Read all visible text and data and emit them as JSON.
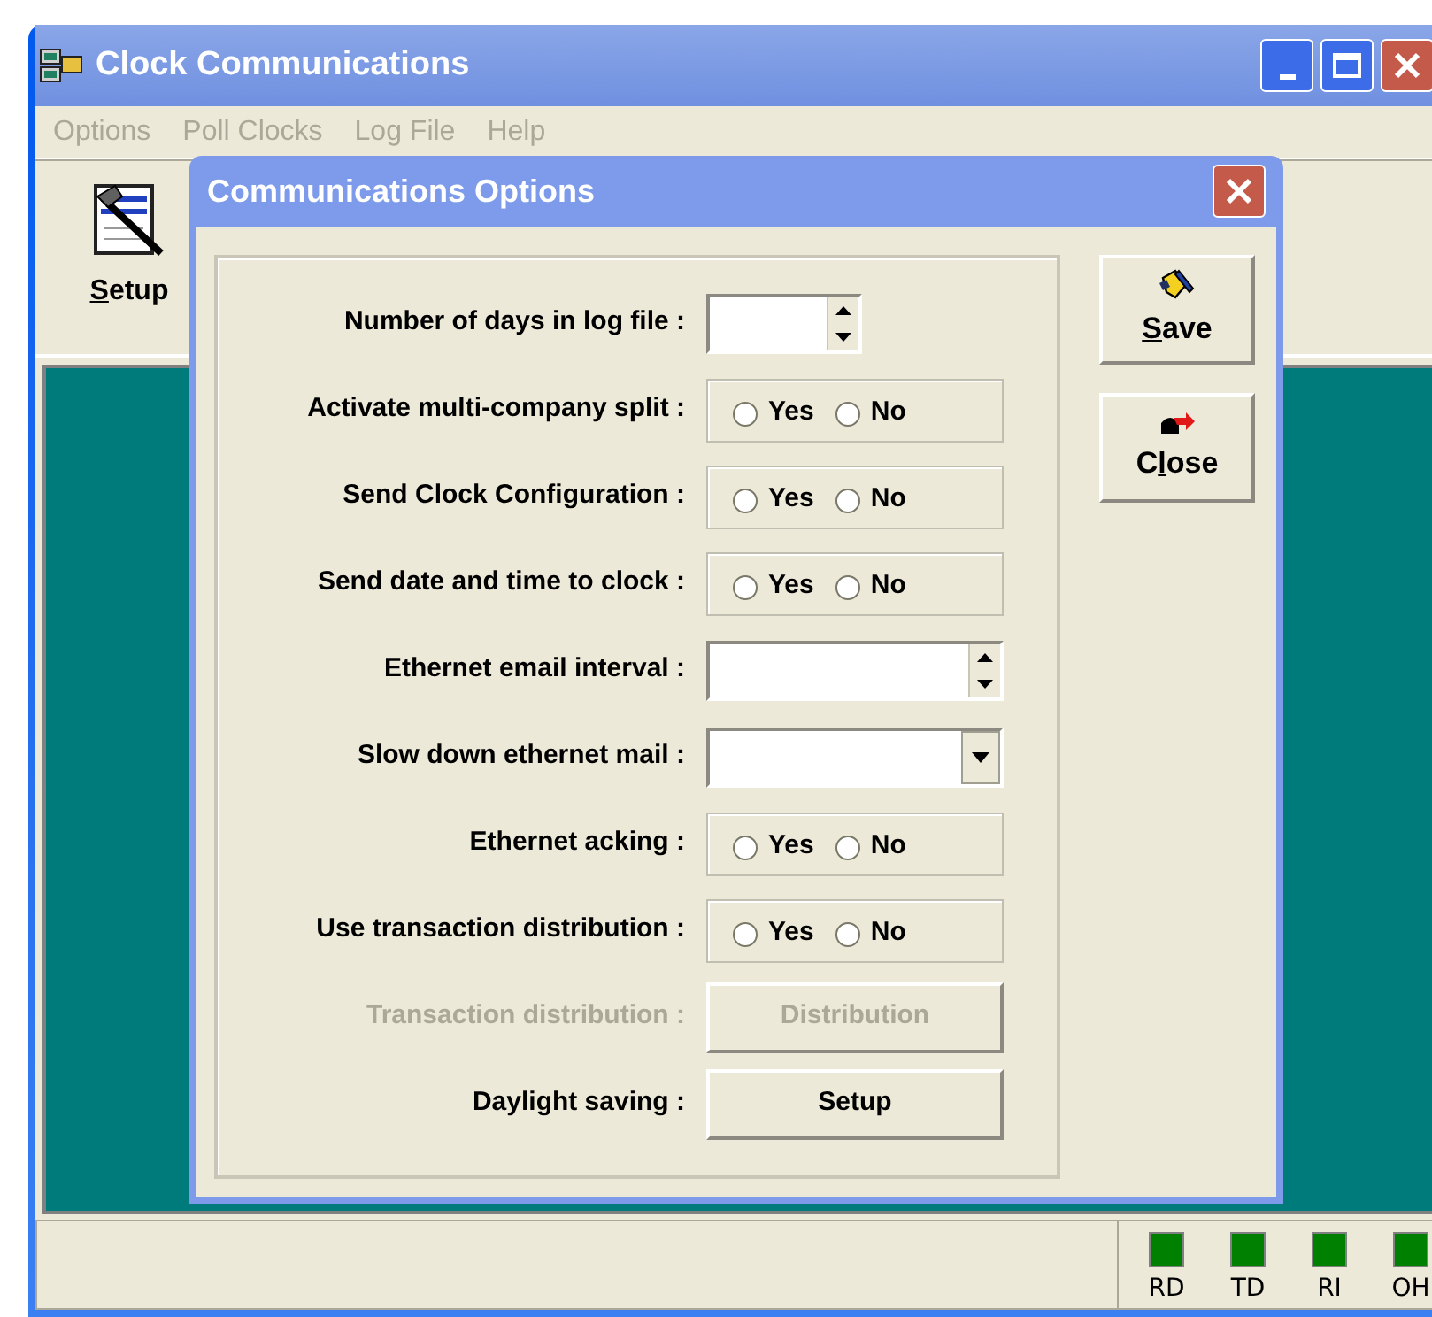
{
  "window": {
    "title": "Clock Communications"
  },
  "menu": [
    {
      "label": "Options",
      "disabled": true
    },
    {
      "label": "Poll Clocks",
      "disabled": true
    },
    {
      "label": "Log File",
      "disabled": true
    },
    {
      "label": "Help",
      "disabled": true
    }
  ],
  "toolbar": [
    {
      "label": "Setup"
    }
  ],
  "dialog": {
    "title": "Communications Options",
    "rows": [
      {
        "kind": "spin",
        "label": "Number of days in log file :",
        "compact": true,
        "disabled": false
      },
      {
        "kind": "radio",
        "label": "Activate multi-company split :",
        "disabled": false,
        "options": [
          {
            "label": "Yes",
            "selected": false
          },
          {
            "label": "No",
            "selected": false
          }
        ]
      },
      {
        "kind": "radio",
        "label": "Send Clock Configuration :",
        "disabled": false,
        "options": [
          {
            "label": "Yes",
            "selected": false
          },
          {
            "label": "No",
            "selected": false
          }
        ]
      },
      {
        "kind": "radio",
        "label": "Send date and time to clock :",
        "disabled": false,
        "options": [
          {
            "label": "Yes",
            "selected": false
          },
          {
            "label": "No",
            "selected": false
          }
        ]
      },
      {
        "kind": "spin",
        "label": "Ethernet email interval :",
        "compact": false,
        "disabled": false
      },
      {
        "kind": "dropdown",
        "label": "Slow down ethernet mail :",
        "disabled": false
      },
      {
        "kind": "radio",
        "label": "Ethernet acking :",
        "disabled": false,
        "options": [
          {
            "label": "Yes",
            "selected": false
          },
          {
            "label": "No",
            "selected": false
          }
        ]
      },
      {
        "kind": "radio",
        "label": "Use transaction distribution :",
        "disabled": false,
        "options": [
          {
            "label": "Yes",
            "selected": false
          },
          {
            "label": "No",
            "selected": false
          }
        ]
      },
      {
        "kind": "button",
        "label": "Transaction distribution :",
        "button": "Distribution",
        "disabled": true
      },
      {
        "kind": "button",
        "label": "Daylight saving :",
        "button": "Setup",
        "disabled": false
      }
    ],
    "buttons": [
      {
        "label": "Save",
        "kind": "save"
      },
      {
        "label": "Close",
        "kind": "close"
      }
    ]
  },
  "status_bar": {
    "indicators": [
      {
        "label": "RD",
        "on": true
      },
      {
        "label": "TD",
        "on": true
      },
      {
        "label": "RI",
        "on": true
      },
      {
        "label": "OH",
        "on": true
      }
    ]
  }
}
